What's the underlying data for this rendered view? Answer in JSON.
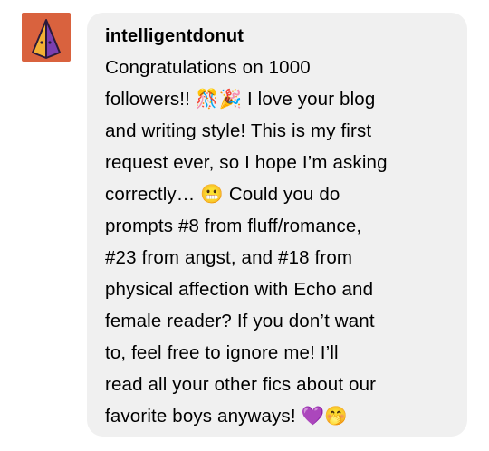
{
  "post": {
    "avatar_icon": "pyramid-avatar-icon",
    "username": "intelligentdonut",
    "message": "Congratulations on 1000\nfollowers!! 🎊🎉 I love your blog\nand writing style! This is my first\nrequest ever, so I hope I’m asking\ncorrectly… 😬 Could you do\nprompts #8 from fluff/romance,\n#23 from angst, and #18 from\nphysical affection with Echo and\nfemale reader? If you don’t want\nto, feel free to ignore me! I’ll\nread all your other fics about our\nfavorite boys anyways! 💜🤭"
  },
  "colors": {
    "avatar_bg": "#d9623e",
    "bubble_bg": "#f0f0f0",
    "text": "#000000"
  }
}
